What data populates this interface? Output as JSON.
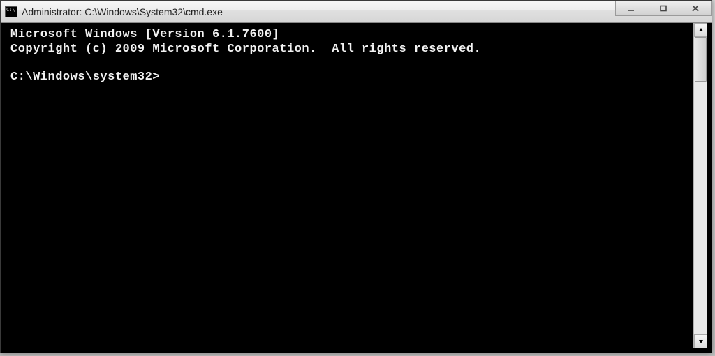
{
  "window": {
    "title": "Administrator: C:\\Windows\\System32\\cmd.exe"
  },
  "terminal": {
    "line1": "Microsoft Windows [Version 6.1.7600]",
    "line2": "Copyright (c) 2009 Microsoft Corporation.  All rights reserved.",
    "prompt": "C:\\Windows\\system32>"
  }
}
